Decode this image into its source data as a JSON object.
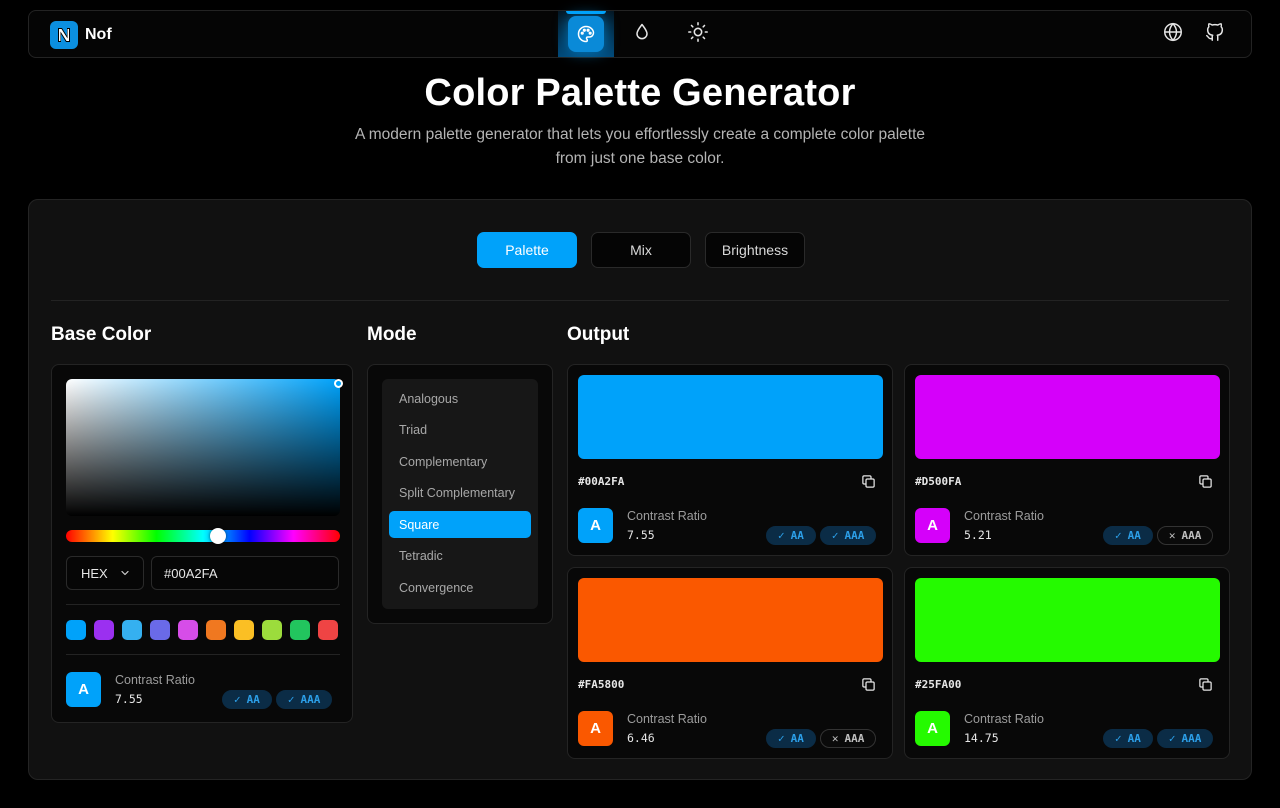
{
  "header": {
    "brand_name": "Nof",
    "nav": [
      {
        "icon": "palette-icon",
        "active": true
      },
      {
        "icon": "droplet-icon",
        "active": false
      },
      {
        "icon": "sun-icon",
        "active": false
      }
    ],
    "right_icons": [
      "globe-icon",
      "github-icon"
    ]
  },
  "hero": {
    "title": "Color Palette Generator",
    "subtitle": "A modern palette generator that lets you effortlessly create a complete color palette from just one base color."
  },
  "tabs": [
    {
      "label": "Palette",
      "active": true
    },
    {
      "label": "Mix",
      "active": false
    },
    {
      "label": "Brightness",
      "active": false
    }
  ],
  "base_color": {
    "title": "Base Color",
    "format": "HEX",
    "hex_value": "#00A2FA",
    "hue_fraction": 0.56,
    "swatches": [
      "#00a2fa",
      "#9b30f0",
      "#35b0f0",
      "#6a6ae8",
      "#d64de8",
      "#f07820",
      "#fbbf24",
      "#9cdc3c",
      "#22c55e",
      "#ef4444"
    ],
    "contrast": {
      "label": "Contrast Ratio",
      "value": "7.55",
      "chip": "A",
      "aa": "AA",
      "aaa": "AAA",
      "aa_pass": true,
      "aaa_pass": true
    }
  },
  "mode": {
    "title": "Mode",
    "items": [
      "Analogous",
      "Triad",
      "Complementary",
      "Split Complementary",
      "Square",
      "Tetradic",
      "Convergence"
    ],
    "selected": "Square"
  },
  "output": {
    "title": "Output",
    "colors": [
      {
        "hex": "#00A2FA",
        "color": "#00A2FA",
        "contrast_label": "Contrast Ratio",
        "contrast": "7.55",
        "chip": "A",
        "aa": "AA",
        "aaa": "AAA",
        "aa_pass": true,
        "aaa_pass": true
      },
      {
        "hex": "#D500FA",
        "color": "#D500FA",
        "contrast_label": "Contrast Ratio",
        "contrast": "5.21",
        "chip": "A",
        "aa": "AA",
        "aaa": "AAA",
        "aa_pass": true,
        "aaa_pass": false
      },
      {
        "hex": "#FA5800",
        "color": "#FA5800",
        "contrast_label": "Contrast Ratio",
        "contrast": "6.46",
        "chip": "A",
        "aa": "AA",
        "aaa": "AAA",
        "aa_pass": true,
        "aaa_pass": false
      },
      {
        "hex": "#25FA00",
        "color": "#25FA00",
        "contrast_label": "Contrast Ratio",
        "contrast": "14.75",
        "chip": "A",
        "aa": "AA",
        "aaa": "AAA",
        "aa_pass": true,
        "aaa_pass": true
      }
    ]
  },
  "colors": {
    "accent": "#00A2FA",
    "background": "#000000",
    "panel": "#111111",
    "pass_text": "#2C9FE8"
  }
}
